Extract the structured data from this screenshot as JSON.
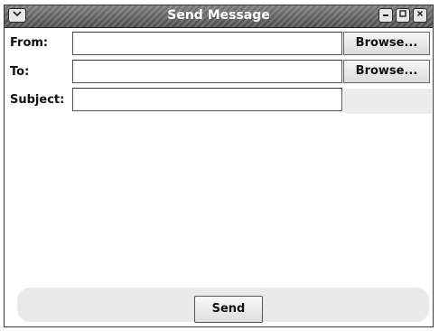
{
  "window": {
    "title": "Send Message",
    "controls": {
      "menu_icon": "chevron-down-icon",
      "minimize_icon": "minimize-icon",
      "maximize_icon": "maximize-icon",
      "close_icon": "close-icon"
    }
  },
  "form": {
    "from_label": "From:",
    "from_value": "",
    "to_label": "To:",
    "to_value": "",
    "subject_label": "Subject:",
    "subject_value": "",
    "browse_label": "Browse...",
    "send_label": "Send"
  }
}
